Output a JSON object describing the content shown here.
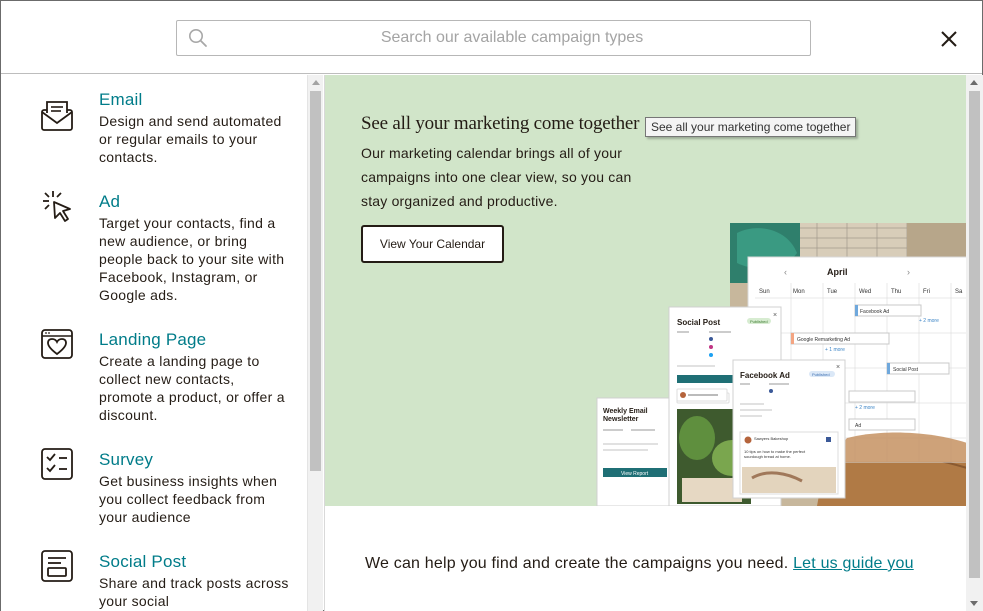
{
  "search": {
    "placeholder": "Search our available campaign types",
    "icon": "search-icon"
  },
  "close_icon": "close-icon",
  "campaign_types": [
    {
      "title": "Email",
      "description": "Design and send automated or regular emails to your contacts.",
      "icon": "envelope-icon"
    },
    {
      "title": "Ad",
      "description": "Target your contacts, find a new audience, or bring people back to your site with Facebook, Instagram, or Google ads.",
      "icon": "cursor-click-icon"
    },
    {
      "title": "Landing Page",
      "description": "Create a landing page to collect new contacts, promote a product, or offer a discount.",
      "icon": "heart-page-icon"
    },
    {
      "title": "Survey",
      "description": "Get business insights when you collect feedback from your audience",
      "icon": "checklist-icon"
    },
    {
      "title": "Social Post",
      "description": "Share and track posts across your social",
      "icon": "social-post-icon"
    }
  ],
  "promo": {
    "title": "See all your marketing come together",
    "tooltip": "See all your marketing come together",
    "description": "Our marketing calendar brings all of your campaigns into one clear view, so you can stay organized and productive.",
    "cta_label": "View Your Calendar",
    "background_color": "#d1e5c9"
  },
  "illustration": {
    "calendar_month": "April",
    "weekdays": [
      "Sun",
      "Mon",
      "Tue",
      "Wed",
      "Thu",
      "Fri",
      "Sa"
    ],
    "events": [
      "Facebook Ad",
      "Google Remarketing Ad",
      "Social Post",
      "Ad"
    ],
    "more_links": [
      "+ 2 more",
      "+ 1 more",
      "+ 2 more"
    ],
    "cards": {
      "social_post": {
        "title": "Social Post",
        "badge": "Published",
        "channels": [
          "Facebook",
          "Instagram",
          "Twitter"
        ]
      },
      "facebook_ad": {
        "title": "Facebook Ad",
        "badge": "Published",
        "account": "Sawyers Bakeshop",
        "caption": "10 tips on how to make the perfect sourdough bread at home."
      },
      "newsletter": {
        "title": "Weekly Email Newsletter",
        "button": "View Report"
      }
    }
  },
  "footer": {
    "text": "We can help you find and create the campaigns you need.",
    "link": "Let us guide you"
  },
  "colors": {
    "accent": "#007c89",
    "text": "#241c15"
  }
}
